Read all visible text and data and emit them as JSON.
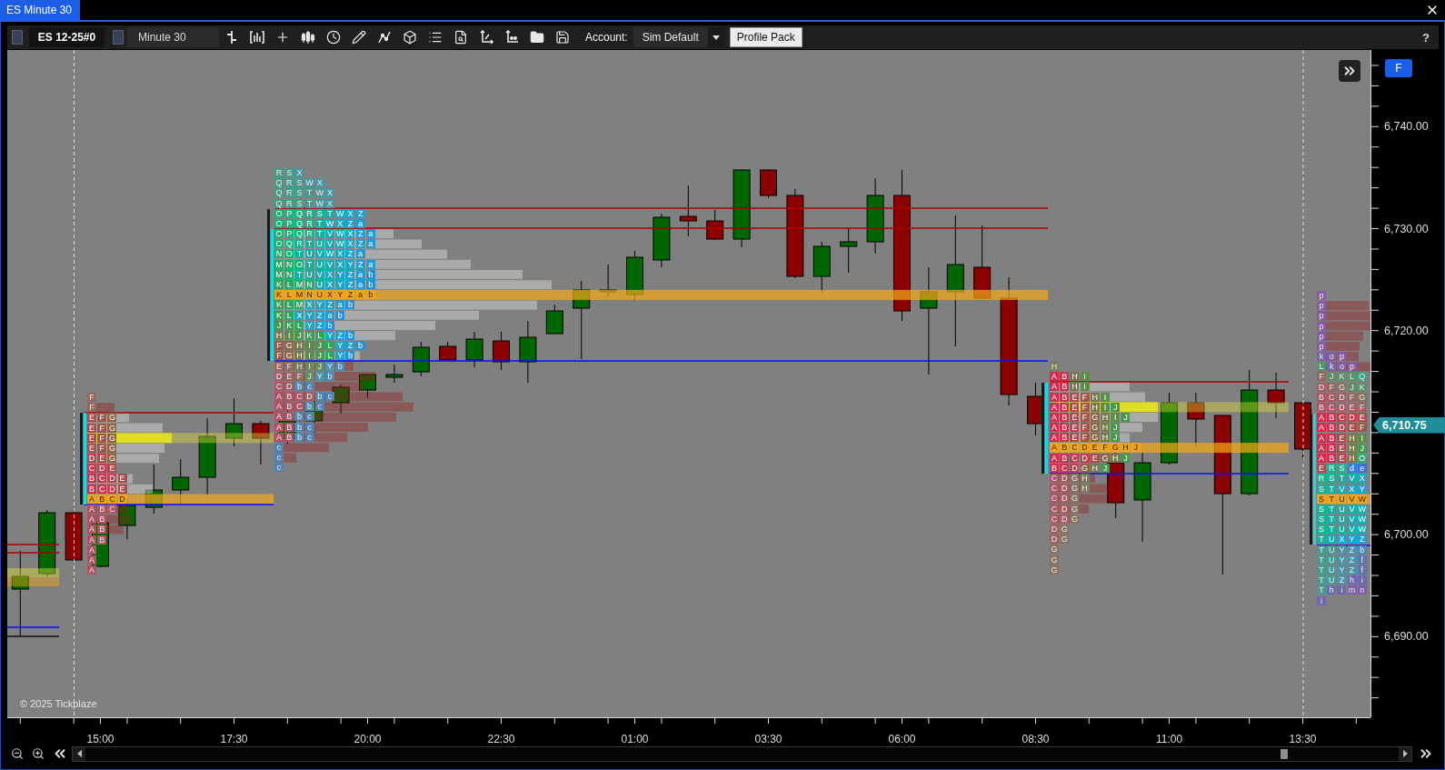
{
  "tabs": [
    {
      "label": "ES Minute 30",
      "selected": true
    }
  ],
  "toolbar": {
    "instrument": "ES 12-25#0",
    "timeframe": "Minute 30",
    "account_label": "Account:",
    "account": "Sim Default",
    "profile_button": "Profile Pack",
    "help": "?"
  },
  "chart": {
    "profiles": [
      {
        "rows": [
          {
            "letters": "F",
            "in_value_area": false,
            "kind": "normal"
          },
          {
            "letters": "F",
            "in_value_area": false,
            "kind": "normal"
          },
          {
            "letters": "E F G",
            "in_value_area": true,
            "kind": "normal"
          },
          {
            "letters": "E F G",
            "in_value_area": true,
            "kind": "normal"
          },
          {
            "letters": "E F G",
            "in_value_area": true,
            "kind": "normal"
          },
          {
            "letters": "E F G",
            "in_value_area": true,
            "kind": "normal"
          },
          {
            "letters": "D E G",
            "in_value_area": true,
            "kind": "normal"
          },
          {
            "letters": "C D E",
            "in_value_area": true,
            "kind": "normal"
          },
          {
            "letters": "B C D E",
            "in_value_area": true,
            "kind": "normal"
          },
          {
            "letters": "B C D E",
            "in_value_area": true,
            "kind": "normal"
          },
          {
            "letters": "A B C D",
            "in_value_area": true,
            "kind": "poc"
          },
          {
            "letters": "A B C",
            "in_value_area": false,
            "kind": "normal"
          },
          {
            "letters": "A B",
            "in_value_area": false,
            "kind": "normal"
          },
          {
            "letters": "A B",
            "in_value_area": false,
            "kind": "normal"
          },
          {
            "letters": "A B",
            "in_value_area": false,
            "kind": "normal"
          },
          {
            "letters": "A",
            "in_value_area": false,
            "kind": "normal"
          },
          {
            "letters": "A",
            "in_value_area": false,
            "kind": "normal"
          },
          {
            "letters": "A",
            "in_value_area": false,
            "kind": "normal"
          }
        ]
      },
      {
        "rows": [
          {
            "letters": "R S X",
            "in_value_area": false,
            "kind": "normal"
          },
          {
            "letters": "Q R S W X",
            "in_value_area": false,
            "kind": "normal"
          },
          {
            "letters": "Q R S T W X",
            "in_value_area": false,
            "kind": "normal"
          },
          {
            "letters": "Q R S T W X",
            "in_value_area": false,
            "kind": "normal"
          },
          {
            "letters": "O P Q R S T W X Z",
            "in_value_area": true,
            "kind": "normal"
          },
          {
            "letters": "O P Q R T W X Z a",
            "in_value_area": true,
            "kind": "normal"
          },
          {
            "letters": "O P Q R T V W X Z a",
            "in_value_area": true,
            "kind": "normal"
          },
          {
            "letters": "O Q R T U V W X Z a",
            "in_value_area": true,
            "kind": "normal"
          },
          {
            "letters": "N O T U V W X Z a",
            "in_value_area": true,
            "kind": "normal"
          },
          {
            "letters": "M N O T U V X Y Z a",
            "in_value_area": true,
            "kind": "normal"
          },
          {
            "letters": "M N T U V X Y Z a b",
            "in_value_area": true,
            "kind": "normal"
          },
          {
            "letters": "K L M N U X Y Z a b",
            "in_value_area": true,
            "kind": "normal"
          },
          {
            "letters": "K L M N U X Y Z a b",
            "in_value_area": true,
            "kind": "poc"
          },
          {
            "letters": "K L M X Y Z a b",
            "in_value_area": true,
            "kind": "normal"
          },
          {
            "letters": "K L X Y Z a b",
            "in_value_area": true,
            "kind": "normal"
          },
          {
            "letters": "J K L Y Z b",
            "in_value_area": true,
            "kind": "normal"
          },
          {
            "letters": "H I J K L Y Z b",
            "in_value_area": true,
            "kind": "normal"
          },
          {
            "letters": "F G H I J L Y Z b",
            "in_value_area": true,
            "kind": "normal"
          },
          {
            "letters": "F G H I J L Y b",
            "in_value_area": true,
            "kind": "normal"
          },
          {
            "letters": "E F H I J Y b",
            "in_value_area": false,
            "kind": "normal"
          },
          {
            "letters": "D E F J Y b",
            "in_value_area": false,
            "kind": "normal"
          },
          {
            "letters": "C D b c",
            "in_value_area": false,
            "kind": "normal"
          },
          {
            "letters": "A B C D b c",
            "in_value_area": false,
            "kind": "normal"
          },
          {
            "letters": "A B C b c",
            "in_value_area": false,
            "kind": "normal"
          },
          {
            "letters": "A B b c",
            "in_value_area": false,
            "kind": "normal"
          },
          {
            "letters": "A B b c",
            "in_value_area": false,
            "kind": "normal"
          },
          {
            "letters": "A B b c",
            "in_value_area": false,
            "kind": "normal"
          },
          {
            "letters": "c",
            "in_value_area": false,
            "kind": "normal"
          },
          {
            "letters": "c",
            "in_value_area": false,
            "kind": "normal"
          },
          {
            "letters": "c",
            "in_value_area": false,
            "kind": "normal"
          }
        ]
      },
      {
        "rows": [
          {
            "letters": "H",
            "in_value_area": false,
            "kind": "normal"
          },
          {
            "letters": "A B H I",
            "in_value_area": true,
            "kind": "normal"
          },
          {
            "letters": "A B H I",
            "in_value_area": true,
            "kind": "normal"
          },
          {
            "letters": "A B E F H I",
            "in_value_area": true,
            "kind": "normal"
          },
          {
            "letters": "A B E F H I J",
            "in_value_area": true,
            "kind": "normal"
          },
          {
            "letters": "A B E F G H I J",
            "in_value_area": true,
            "kind": "normal"
          },
          {
            "letters": "A B E F G H J",
            "in_value_area": true,
            "kind": "normal"
          },
          {
            "letters": "A B E F G H J",
            "in_value_area": true,
            "kind": "normal"
          },
          {
            "letters": "A B C D E F G H J",
            "in_value_area": true,
            "kind": "poc"
          },
          {
            "letters": "A B C D E G H J",
            "in_value_area": true,
            "kind": "normal"
          },
          {
            "letters": "B C D G H J",
            "in_value_area": true,
            "kind": "normal"
          },
          {
            "letters": "C D G H",
            "in_value_area": false,
            "kind": "normal"
          },
          {
            "letters": "C D G H",
            "in_value_area": false,
            "kind": "normal"
          },
          {
            "letters": "C D G",
            "in_value_area": false,
            "kind": "normal"
          },
          {
            "letters": "C D G",
            "in_value_area": false,
            "kind": "normal"
          },
          {
            "letters": "C D G",
            "in_value_area": false,
            "kind": "normal"
          },
          {
            "letters": "D G",
            "in_value_area": false,
            "kind": "normal"
          },
          {
            "letters": "D G",
            "in_value_area": false,
            "kind": "normal"
          },
          {
            "letters": "G",
            "in_value_area": false,
            "kind": "normal"
          },
          {
            "letters": "G",
            "in_value_area": false,
            "kind": "normal"
          },
          {
            "letters": "G",
            "in_value_area": false,
            "kind": "normal"
          }
        ]
      },
      {
        "rows": [
          {
            "letters": "p",
            "in_value_area": false,
            "kind": "normal"
          },
          {
            "letters": "p",
            "in_value_area": false,
            "kind": "normal"
          },
          {
            "letters": "p",
            "in_value_area": false,
            "kind": "normal"
          },
          {
            "letters": "p",
            "in_value_area": false,
            "kind": "normal"
          },
          {
            "letters": "p",
            "in_value_area": false,
            "kind": "normal"
          },
          {
            "letters": "p",
            "in_value_area": false,
            "kind": "normal"
          },
          {
            "letters": "k o p",
            "in_value_area": false,
            "kind": "normal"
          },
          {
            "letters": "L k o p",
            "in_value_area": false,
            "kind": "normal"
          },
          {
            "letters": "F J K L Q",
            "in_value_area": false,
            "kind": "normal"
          },
          {
            "letters": "D F G J K",
            "in_value_area": false,
            "kind": "normal"
          },
          {
            "letters": "B C D F G",
            "in_value_area": false,
            "kind": "normal"
          },
          {
            "letters": "B C D E F",
            "in_value_area": false,
            "kind": "normal"
          },
          {
            "letters": "A B C D E",
            "in_value_area": true,
            "kind": "normal"
          },
          {
            "letters": "A B D E F",
            "in_value_area": true,
            "kind": "normal"
          },
          {
            "letters": "A B E H I",
            "in_value_area": true,
            "kind": "normal"
          },
          {
            "letters": "A B E H J",
            "in_value_area": true,
            "kind": "normal"
          },
          {
            "letters": "A B E H O",
            "in_value_area": true,
            "kind": "normal"
          },
          {
            "letters": "E R S d e",
            "in_value_area": true,
            "kind": "normal"
          },
          {
            "letters": "R S T V X",
            "in_value_area": true,
            "kind": "normal"
          },
          {
            "letters": "S T V X Y",
            "in_value_area": true,
            "kind": "normal"
          },
          {
            "letters": "S T U V W",
            "in_value_area": true,
            "kind": "poc"
          },
          {
            "letters": "S T U V W",
            "in_value_area": true,
            "kind": "normal"
          },
          {
            "letters": "S T U V W",
            "in_value_area": true,
            "kind": "normal"
          },
          {
            "letters": "S T U V W",
            "in_value_area": true,
            "kind": "normal"
          },
          {
            "letters": "T U X Y Z",
            "in_value_area": true,
            "kind": "normal"
          },
          {
            "letters": "T U Y Z b",
            "in_value_area": false,
            "kind": "normal"
          },
          {
            "letters": "T U Y Z f",
            "in_value_area": false,
            "kind": "normal"
          },
          {
            "letters": "T U Y Z f",
            "in_value_area": false,
            "kind": "normal"
          },
          {
            "letters": "T U Z h i",
            "in_value_area": false,
            "kind": "normal"
          },
          {
            "letters": "T h i m n",
            "in_value_area": false,
            "kind": "normal"
          },
          {
            "letters": "i",
            "in_value_area": false,
            "kind": "normal"
          }
        ]
      }
    ],
    "copyright": "© 2025 Tickblaze"
  },
  "price_axis": {
    "labels": [
      "6,740.00",
      "6,730.00",
      "6,720.00",
      "6,700.00",
      "6,690.00"
    ],
    "current_price": "6,710.75",
    "button": "F"
  },
  "time_axis": {
    "labels": [
      "15:00",
      "17:30",
      "20:00",
      "22:30",
      "01:00",
      "03:30",
      "06:00",
      "08:30",
      "11:00",
      "13:30"
    ]
  }
}
